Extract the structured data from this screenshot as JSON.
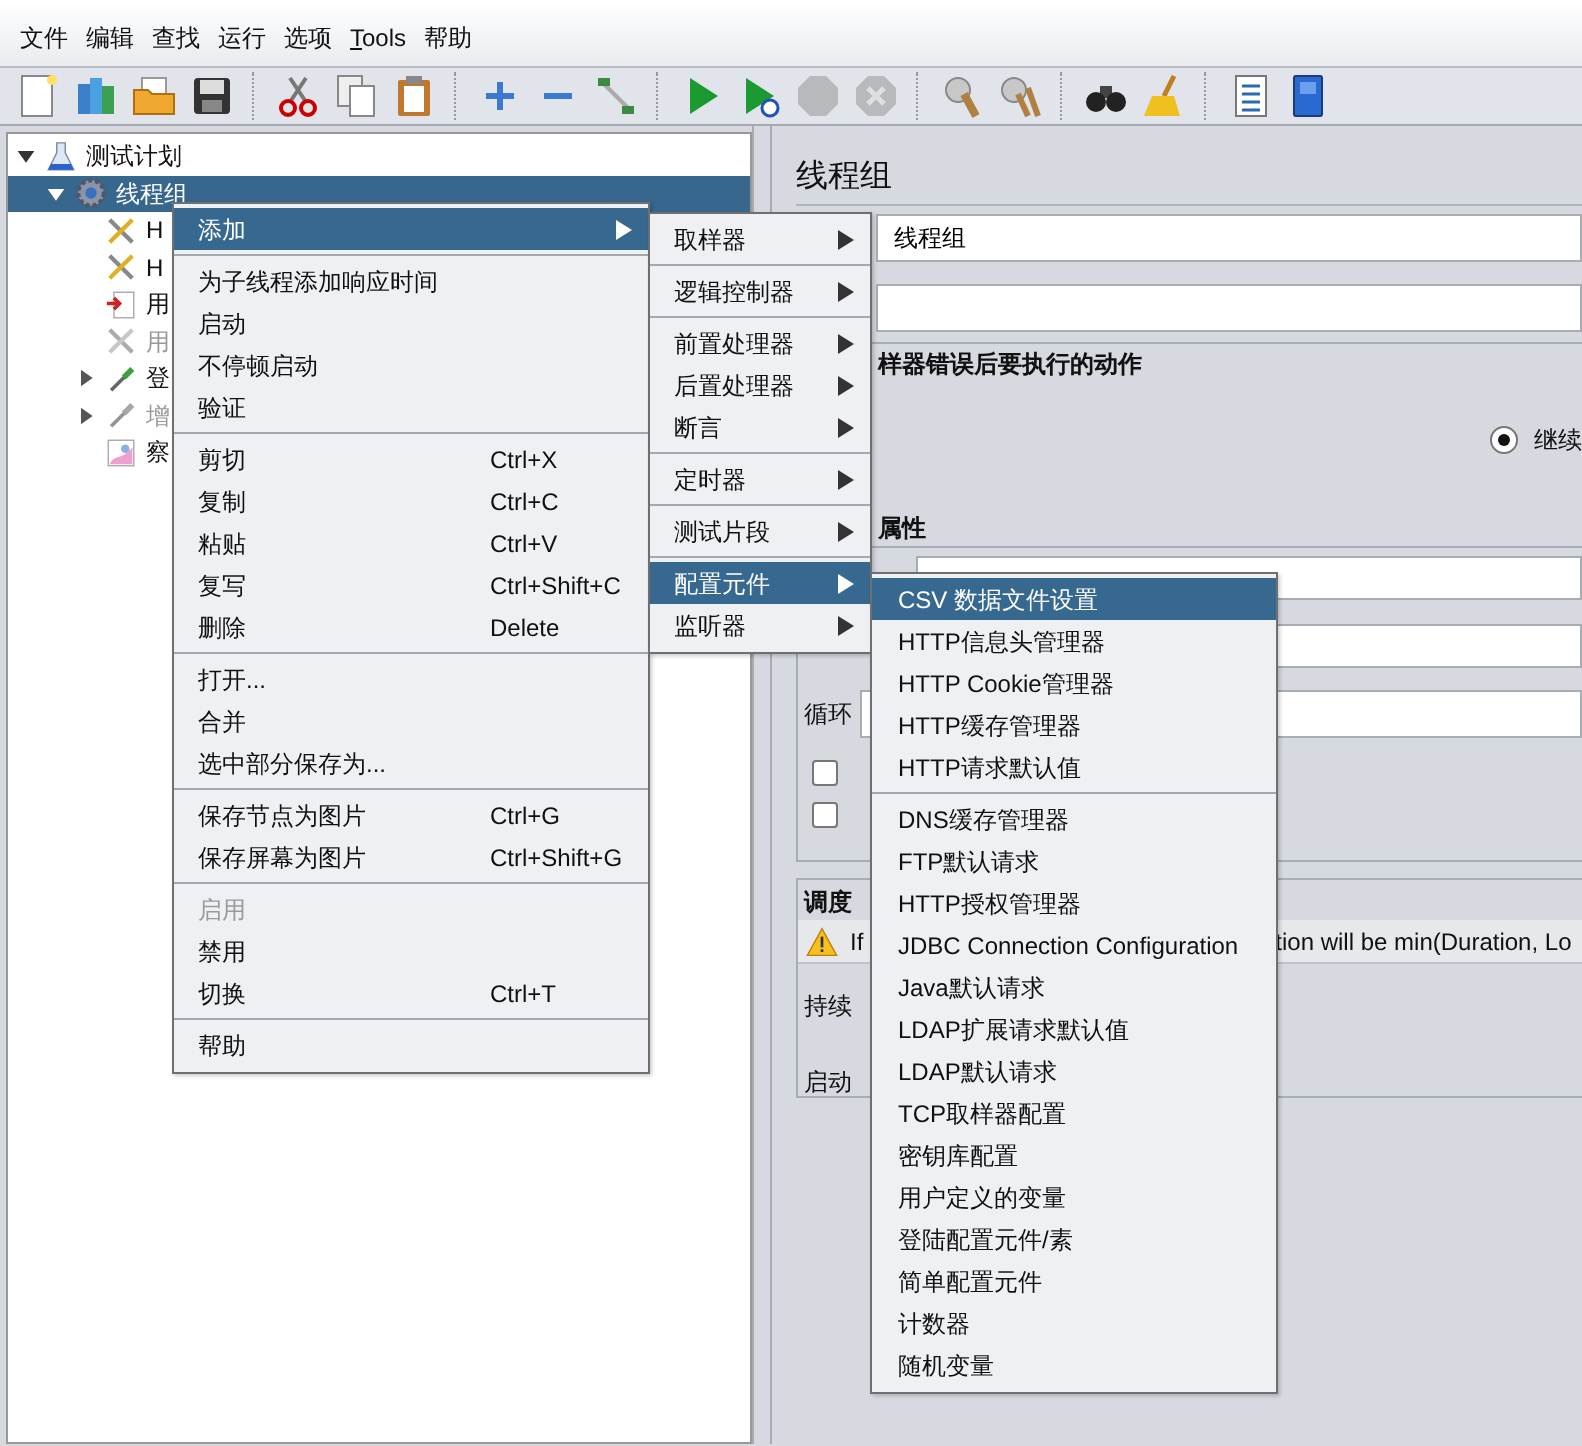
{
  "menu_bar": [
    {
      "label": "文件"
    },
    {
      "label": "编辑"
    },
    {
      "label": "查找"
    },
    {
      "label": "运行"
    },
    {
      "label": "选项"
    },
    {
      "label": "Tools",
      "mnemonic_underlined": true
    },
    {
      "label": "帮助"
    }
  ],
  "toolbar": {
    "groups": [
      {
        "buttons": [
          {
            "kind": "new",
            "disabled": false
          },
          {
            "kind": "templates",
            "disabled": false
          },
          {
            "kind": "open",
            "disabled": false
          },
          {
            "kind": "save",
            "disabled": false
          }
        ]
      },
      {
        "buttons": [
          {
            "kind": "cut",
            "disabled": false
          },
          {
            "kind": "copy",
            "disabled": false
          },
          {
            "kind": "paste",
            "disabled": false
          }
        ]
      },
      {
        "buttons": [
          {
            "kind": "expand",
            "disabled": false
          },
          {
            "kind": "collapse",
            "disabled": false
          },
          {
            "kind": "toggle",
            "disabled": false
          }
        ]
      },
      {
        "buttons": [
          {
            "kind": "start",
            "disabled": false
          },
          {
            "kind": "start_no_pause",
            "disabled": false
          },
          {
            "kind": "stop",
            "disabled": true
          },
          {
            "kind": "shutdown",
            "disabled": true
          }
        ]
      },
      {
        "buttons": [
          {
            "kind": "clear",
            "disabled": false
          },
          {
            "kind": "clear_all",
            "disabled": false
          }
        ]
      },
      {
        "buttons": [
          {
            "kind": "search",
            "disabled": false
          },
          {
            "kind": "reset",
            "disabled": false
          }
        ]
      },
      {
        "buttons": [
          {
            "kind": "functions",
            "disabled": false
          },
          {
            "kind": "help",
            "disabled": false
          }
        ]
      }
    ]
  },
  "tree": [
    {
      "label": "测试计划",
      "kind": "flask",
      "expanded": true,
      "selected": false,
      "disabled": false,
      "children": [
        {
          "label": "线程组",
          "kind": "gear",
          "expanded": true,
          "selected": true,
          "disabled": false,
          "children": [
            {
              "label": "H",
              "kind": "tools",
              "selected": false,
              "disabled": false
            },
            {
              "label": "H",
              "kind": "tools",
              "selected": false,
              "disabled": false
            },
            {
              "label": "用",
              "kind": "doc_arrow",
              "selected": false,
              "disabled": false
            },
            {
              "label": "用",
              "kind": "tools",
              "selected": false,
              "disabled": true
            },
            {
              "label": "登",
              "kind": "dropper",
              "expanded": false,
              "selected": false,
              "disabled": false
            },
            {
              "label": "增",
              "kind": "dropper",
              "expanded": false,
              "selected": false,
              "disabled": true
            },
            {
              "label": "察",
              "kind": "graph",
              "selected": false,
              "disabled": false
            }
          ]
        }
      ]
    }
  ],
  "panel": {
    "title": "线程组",
    "fields": [
      {
        "value": "线程组"
      }
    ],
    "error_action": {
      "heading": "样器错误后要执行的动作",
      "options": [
        {
          "label": "继续",
          "selected": true
        }
      ]
    },
    "properties": {
      "heading": "属性",
      "loop_label": "循环",
      "checkboxes": [
        {
          "checked": false
        },
        {
          "checked": false
        }
      ]
    },
    "scheduler": {
      "heading": "调度",
      "warning_start": "If",
      "warning_end": "tion will be min(Duration, Lo",
      "labels": [
        "持续",
        "启动"
      ]
    }
  },
  "context_menu": {
    "items": [
      {
        "kind": "item",
        "label": "添加",
        "has_submenu": true,
        "selected": true,
        "disabled": false,
        "submenu": {
          "items": [
            {
              "kind": "item",
              "label": "取样器",
              "has_submenu": true,
              "selected": false,
              "disabled": false
            },
            {
              "kind": "separator"
            },
            {
              "kind": "item",
              "label": "逻辑控制器",
              "has_submenu": true,
              "selected": false,
              "disabled": false
            },
            {
              "kind": "separator"
            },
            {
              "kind": "item",
              "label": "前置处理器",
              "has_submenu": true,
              "selected": false,
              "disabled": false
            },
            {
              "kind": "item",
              "label": "后置处理器",
              "has_submenu": true,
              "selected": false,
              "disabled": false
            },
            {
              "kind": "item",
              "label": "断言",
              "has_submenu": true,
              "selected": false,
              "disabled": false
            },
            {
              "kind": "separator"
            },
            {
              "kind": "item",
              "label": "定时器",
              "has_submenu": true,
              "selected": false,
              "disabled": false
            },
            {
              "kind": "separator"
            },
            {
              "kind": "item",
              "label": "测试片段",
              "has_submenu": true,
              "selected": false,
              "disabled": false
            },
            {
              "kind": "separator"
            },
            {
              "kind": "item",
              "label": "配置元件",
              "has_submenu": true,
              "selected": true,
              "disabled": false,
              "submenu": {
                "items": [
                  {
                    "kind": "item",
                    "label": "CSV 数据文件设置",
                    "has_submenu": false,
                    "selected": true,
                    "disabled": false
                  },
                  {
                    "kind": "item",
                    "label": "HTTP信息头管理器",
                    "has_submenu": false,
                    "selected": false,
                    "disabled": false
                  },
                  {
                    "kind": "item",
                    "label": "HTTP Cookie管理器",
                    "has_submenu": false,
                    "selected": false,
                    "disabled": false
                  },
                  {
                    "kind": "item",
                    "label": "HTTP缓存管理器",
                    "has_submenu": false,
                    "selected": false,
                    "disabled": false
                  },
                  {
                    "kind": "item",
                    "label": "HTTP请求默认值",
                    "has_submenu": false,
                    "selected": false,
                    "disabled": false
                  },
                  {
                    "kind": "separator"
                  },
                  {
                    "kind": "item",
                    "label": "DNS缓存管理器",
                    "has_submenu": false,
                    "selected": false,
                    "disabled": false
                  },
                  {
                    "kind": "item",
                    "label": "FTP默认请求",
                    "has_submenu": false,
                    "selected": false,
                    "disabled": false
                  },
                  {
                    "kind": "item",
                    "label": "HTTP授权管理器",
                    "has_submenu": false,
                    "selected": false,
                    "disabled": false
                  },
                  {
                    "kind": "item",
                    "label": "JDBC Connection Configuration",
                    "has_submenu": false,
                    "selected": false,
                    "disabled": false
                  },
                  {
                    "kind": "item",
                    "label": "Java默认请求",
                    "has_submenu": false,
                    "selected": false,
                    "disabled": false
                  },
                  {
                    "kind": "item",
                    "label": "LDAP扩展请求默认值",
                    "has_submenu": false,
                    "selected": false,
                    "disabled": false
                  },
                  {
                    "kind": "item",
                    "label": "LDAP默认请求",
                    "has_submenu": false,
                    "selected": false,
                    "disabled": false
                  },
                  {
                    "kind": "item",
                    "label": "TCP取样器配置",
                    "has_submenu": false,
                    "selected": false,
                    "disabled": false
                  },
                  {
                    "kind": "item",
                    "label": "密钥库配置",
                    "has_submenu": false,
                    "selected": false,
                    "disabled": false
                  },
                  {
                    "kind": "item",
                    "label": "用户定义的变量",
                    "has_submenu": false,
                    "selected": false,
                    "disabled": false
                  },
                  {
                    "kind": "item",
                    "label": "登陆配置元件/素",
                    "has_submenu": false,
                    "selected": false,
                    "disabled": false
                  },
                  {
                    "kind": "item",
                    "label": "简单配置元件",
                    "has_submenu": false,
                    "selected": false,
                    "disabled": false
                  },
                  {
                    "kind": "item",
                    "label": "计数器",
                    "has_submenu": false,
                    "selected": false,
                    "disabled": false
                  },
                  {
                    "kind": "item",
                    "label": "随机变量",
                    "has_submenu": false,
                    "selected": false,
                    "disabled": false
                  }
                ]
              }
            },
            {
              "kind": "item",
              "label": "监听器",
              "has_submenu": true,
              "selected": false,
              "disabled": false
            }
          ]
        }
      },
      {
        "kind": "separator"
      },
      {
        "kind": "item",
        "label": "为子线程添加响应时间",
        "has_submenu": false,
        "selected": false,
        "disabled": false
      },
      {
        "kind": "item",
        "label": "启动",
        "has_submenu": false,
        "selected": false,
        "disabled": false
      },
      {
        "kind": "item",
        "label": "不停顿启动",
        "has_submenu": false,
        "selected": false,
        "disabled": false
      },
      {
        "kind": "item",
        "label": "验证",
        "has_submenu": false,
        "selected": false,
        "disabled": false
      },
      {
        "kind": "separator"
      },
      {
        "kind": "item",
        "label": "剪切",
        "shortcut": "Ctrl+X",
        "has_submenu": false,
        "selected": false,
        "disabled": false
      },
      {
        "kind": "item",
        "label": "复制",
        "shortcut": "Ctrl+C",
        "has_submenu": false,
        "selected": false,
        "disabled": false
      },
      {
        "kind": "item",
        "label": "粘贴",
        "shortcut": "Ctrl+V",
        "has_submenu": false,
        "selected": false,
        "disabled": false
      },
      {
        "kind": "item",
        "label": "复写",
        "shortcut": "Ctrl+Shift+C",
        "has_submenu": false,
        "selected": false,
        "disabled": false
      },
      {
        "kind": "item",
        "label": "删除",
        "shortcut": "Delete",
        "has_submenu": false,
        "selected": false,
        "disabled": false
      },
      {
        "kind": "separator"
      },
      {
        "kind": "item",
        "label": "打开...",
        "has_submenu": false,
        "selected": false,
        "disabled": false
      },
      {
        "kind": "item",
        "label": "合并",
        "has_submenu": false,
        "selected": false,
        "disabled": false
      },
      {
        "kind": "item",
        "label": "选中部分保存为...",
        "has_submenu": false,
        "selected": false,
        "disabled": false
      },
      {
        "kind": "separator"
      },
      {
        "kind": "item",
        "label": "保存节点为图片",
        "shortcut": "Ctrl+G",
        "has_submenu": false,
        "selected": false,
        "disabled": false
      },
      {
        "kind": "item",
        "label": "保存屏幕为图片",
        "shortcut": "Ctrl+Shift+G",
        "has_submenu": false,
        "selected": false,
        "disabled": false
      },
      {
        "kind": "separator"
      },
      {
        "kind": "item",
        "label": "启用",
        "has_submenu": false,
        "selected": false,
        "disabled": true
      },
      {
        "kind": "item",
        "label": "禁用",
        "has_submenu": false,
        "selected": false,
        "disabled": false
      },
      {
        "kind": "item",
        "label": "切换",
        "shortcut": "Ctrl+T",
        "has_submenu": false,
        "selected": false,
        "disabled": false
      },
      {
        "kind": "separator"
      },
      {
        "kind": "item",
        "label": "帮助",
        "has_submenu": false,
        "selected": false,
        "disabled": false
      }
    ]
  }
}
